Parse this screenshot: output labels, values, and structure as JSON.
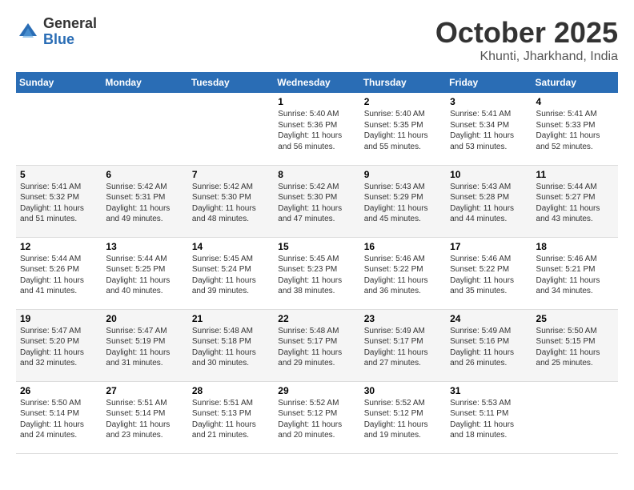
{
  "header": {
    "logo_general": "General",
    "logo_blue": "Blue",
    "month": "October 2025",
    "location": "Khunti, Jharkhand, India"
  },
  "days_of_week": [
    "Sunday",
    "Monday",
    "Tuesday",
    "Wednesday",
    "Thursday",
    "Friday",
    "Saturday"
  ],
  "weeks": [
    [
      {
        "day": "",
        "info": ""
      },
      {
        "day": "",
        "info": ""
      },
      {
        "day": "",
        "info": ""
      },
      {
        "day": "1",
        "info": "Sunrise: 5:40 AM\nSunset: 5:36 PM\nDaylight: 11 hours and 56 minutes."
      },
      {
        "day": "2",
        "info": "Sunrise: 5:40 AM\nSunset: 5:35 PM\nDaylight: 11 hours and 55 minutes."
      },
      {
        "day": "3",
        "info": "Sunrise: 5:41 AM\nSunset: 5:34 PM\nDaylight: 11 hours and 53 minutes."
      },
      {
        "day": "4",
        "info": "Sunrise: 5:41 AM\nSunset: 5:33 PM\nDaylight: 11 hours and 52 minutes."
      }
    ],
    [
      {
        "day": "5",
        "info": "Sunrise: 5:41 AM\nSunset: 5:32 PM\nDaylight: 11 hours and 51 minutes."
      },
      {
        "day": "6",
        "info": "Sunrise: 5:42 AM\nSunset: 5:31 PM\nDaylight: 11 hours and 49 minutes."
      },
      {
        "day": "7",
        "info": "Sunrise: 5:42 AM\nSunset: 5:30 PM\nDaylight: 11 hours and 48 minutes."
      },
      {
        "day": "8",
        "info": "Sunrise: 5:42 AM\nSunset: 5:30 PM\nDaylight: 11 hours and 47 minutes."
      },
      {
        "day": "9",
        "info": "Sunrise: 5:43 AM\nSunset: 5:29 PM\nDaylight: 11 hours and 45 minutes."
      },
      {
        "day": "10",
        "info": "Sunrise: 5:43 AM\nSunset: 5:28 PM\nDaylight: 11 hours and 44 minutes."
      },
      {
        "day": "11",
        "info": "Sunrise: 5:44 AM\nSunset: 5:27 PM\nDaylight: 11 hours and 43 minutes."
      }
    ],
    [
      {
        "day": "12",
        "info": "Sunrise: 5:44 AM\nSunset: 5:26 PM\nDaylight: 11 hours and 41 minutes."
      },
      {
        "day": "13",
        "info": "Sunrise: 5:44 AM\nSunset: 5:25 PM\nDaylight: 11 hours and 40 minutes."
      },
      {
        "day": "14",
        "info": "Sunrise: 5:45 AM\nSunset: 5:24 PM\nDaylight: 11 hours and 39 minutes."
      },
      {
        "day": "15",
        "info": "Sunrise: 5:45 AM\nSunset: 5:23 PM\nDaylight: 11 hours and 38 minutes."
      },
      {
        "day": "16",
        "info": "Sunrise: 5:46 AM\nSunset: 5:22 PM\nDaylight: 11 hours and 36 minutes."
      },
      {
        "day": "17",
        "info": "Sunrise: 5:46 AM\nSunset: 5:22 PM\nDaylight: 11 hours and 35 minutes."
      },
      {
        "day": "18",
        "info": "Sunrise: 5:46 AM\nSunset: 5:21 PM\nDaylight: 11 hours and 34 minutes."
      }
    ],
    [
      {
        "day": "19",
        "info": "Sunrise: 5:47 AM\nSunset: 5:20 PM\nDaylight: 11 hours and 32 minutes."
      },
      {
        "day": "20",
        "info": "Sunrise: 5:47 AM\nSunset: 5:19 PM\nDaylight: 11 hours and 31 minutes."
      },
      {
        "day": "21",
        "info": "Sunrise: 5:48 AM\nSunset: 5:18 PM\nDaylight: 11 hours and 30 minutes."
      },
      {
        "day": "22",
        "info": "Sunrise: 5:48 AM\nSunset: 5:17 PM\nDaylight: 11 hours and 29 minutes."
      },
      {
        "day": "23",
        "info": "Sunrise: 5:49 AM\nSunset: 5:17 PM\nDaylight: 11 hours and 27 minutes."
      },
      {
        "day": "24",
        "info": "Sunrise: 5:49 AM\nSunset: 5:16 PM\nDaylight: 11 hours and 26 minutes."
      },
      {
        "day": "25",
        "info": "Sunrise: 5:50 AM\nSunset: 5:15 PM\nDaylight: 11 hours and 25 minutes."
      }
    ],
    [
      {
        "day": "26",
        "info": "Sunrise: 5:50 AM\nSunset: 5:14 PM\nDaylight: 11 hours and 24 minutes."
      },
      {
        "day": "27",
        "info": "Sunrise: 5:51 AM\nSunset: 5:14 PM\nDaylight: 11 hours and 23 minutes."
      },
      {
        "day": "28",
        "info": "Sunrise: 5:51 AM\nSunset: 5:13 PM\nDaylight: 11 hours and 21 minutes."
      },
      {
        "day": "29",
        "info": "Sunrise: 5:52 AM\nSunset: 5:12 PM\nDaylight: 11 hours and 20 minutes."
      },
      {
        "day": "30",
        "info": "Sunrise: 5:52 AM\nSunset: 5:12 PM\nDaylight: 11 hours and 19 minutes."
      },
      {
        "day": "31",
        "info": "Sunrise: 5:53 AM\nSunset: 5:11 PM\nDaylight: 11 hours and 18 minutes."
      },
      {
        "day": "",
        "info": ""
      }
    ]
  ]
}
